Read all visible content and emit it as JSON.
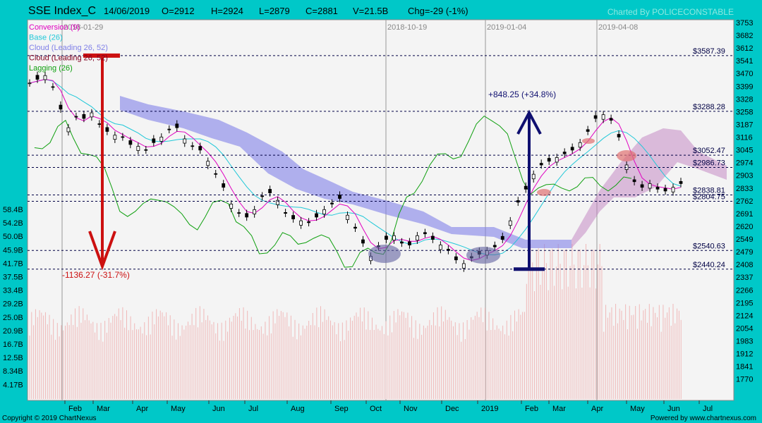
{
  "header": {
    "symbol": "SSE Index_C",
    "date": "14/06/2019",
    "open": "O=2912",
    "high": "H=2924",
    "low": "L=2879",
    "close": "C=2881",
    "volume": "V=21.5B",
    "change": "Chg=-29 (-1%)",
    "credit": "Charted By POLICECONSTABLE"
  },
  "footer": {
    "copyright": "Copyright © 2019 ChartNexus",
    "powered": "Powered by www.chartnexus.com"
  },
  "colors": {
    "background": "#00c8c8",
    "plot": "#f4f4f4",
    "conversion": "#e000c0",
    "base": "#20c8d8",
    "cloud_blue": "#8080e8",
    "cloud_pink": "#c080c0",
    "lagging": "#10a010",
    "volume": "#f0b8b8",
    "arrow_down": "#cc1010",
    "arrow_up": "#101070"
  },
  "chart_data": {
    "type": "line",
    "x_axis": {
      "month_labels": [
        "Feb",
        "Mar",
        "Apr",
        "May",
        "Jun",
        "Jul",
        "Aug",
        "Sep",
        "Oct",
        "Nov",
        "Dec",
        "2019",
        "Feb",
        "Mar",
        "Apr",
        "May",
        "Jun",
        "Jul"
      ]
    },
    "y_axis_price": {
      "ticks": [
        "3753",
        "3682",
        "3612",
        "3541",
        "3470",
        "3399",
        "3328",
        "3258",
        "3187",
        "3116",
        "3045",
        "2974",
        "2903",
        "2833",
        "2762",
        "2691",
        "2620",
        "2549",
        "2479",
        "2408",
        "2337",
        "2266",
        "2195",
        "2124",
        "2054",
        "1983",
        "1912",
        "1841",
        "1770"
      ],
      "ylim": [
        1735,
        3780
      ]
    },
    "y_axis_volume": {
      "ticks": [
        "58.4B",
        "54.2B",
        "50.0B",
        "45.9B",
        "41.7B",
        "37.5B",
        "33.4B",
        "29.2B",
        "25.0B",
        "20.9B",
        "16.7B",
        "12.5B",
        "8.34B",
        "4.17B"
      ]
    },
    "legend": [
      "Conversion (9)",
      "Base (26)",
      "Cloud (Leading 26, 52)",
      "Cloud (Leading 26, 52)",
      "Lagging (26)"
    ],
    "vertical_markers": [
      "2018-01-29",
      "2018-10-19",
      "2019-01-04",
      "2019-04-08"
    ],
    "horizontal_levels": [
      {
        "label": "$3587.39",
        "value": 3587.39
      },
      {
        "label": "$3288.28",
        "value": 3288.28
      },
      {
        "label": "$3052.47",
        "value": 3052.47
      },
      {
        "label": "$2986.73",
        "value": 2986.73
      },
      {
        "label": "$2838.81",
        "value": 2838.81
      },
      {
        "label": "$2804.75",
        "value": 2804.75
      },
      {
        "label": "$2540.63",
        "value": 2540.63
      },
      {
        "label": "$2440.24",
        "value": 2440.24
      }
    ],
    "annotations": [
      {
        "text": "-1136.27 (-31.7%)",
        "from": 3587.39,
        "to": 2440.24,
        "direction": "down"
      },
      {
        "text": "+848.25 (+34.8%)",
        "from": 2440.24,
        "to": 3288.28,
        "direction": "up"
      }
    ],
    "close_series_approx": [
      3440,
      3460,
      3480,
      3420,
      3300,
      3200,
      3260,
      3250,
      3280,
      3220,
      3180,
      3160,
      3150,
      3110,
      3100,
      3080,
      3120,
      3150,
      3190,
      3200,
      3140,
      3100,
      3080,
      3020,
      2950,
      2880,
      2790,
      2740,
      2720,
      2760,
      2830,
      2850,
      2810,
      2740,
      2710,
      2700,
      2690,
      2720,
      2760,
      2790,
      2820,
      2730,
      2660,
      2580,
      2510,
      2560,
      2600,
      2620,
      2580,
      2570,
      2620,
      2630,
      2600,
      2570,
      2540,
      2490,
      2470,
      2500,
      2520,
      2540,
      2560,
      2600,
      2700,
      2800,
      2870,
      2950,
      3000,
      3020,
      3040,
      3060,
      3080,
      3120,
      3180,
      3250,
      3270,
      3240,
      3150,
      3000,
      2910,
      2880,
      2900,
      2870,
      2860,
      2880,
      2900
    ],
    "last_ohlc": {
      "open": 2912,
      "high": 2924,
      "low": 2879,
      "close": 2881,
      "volume": "21.5B",
      "change": -29,
      "change_pct": "-1%"
    }
  }
}
